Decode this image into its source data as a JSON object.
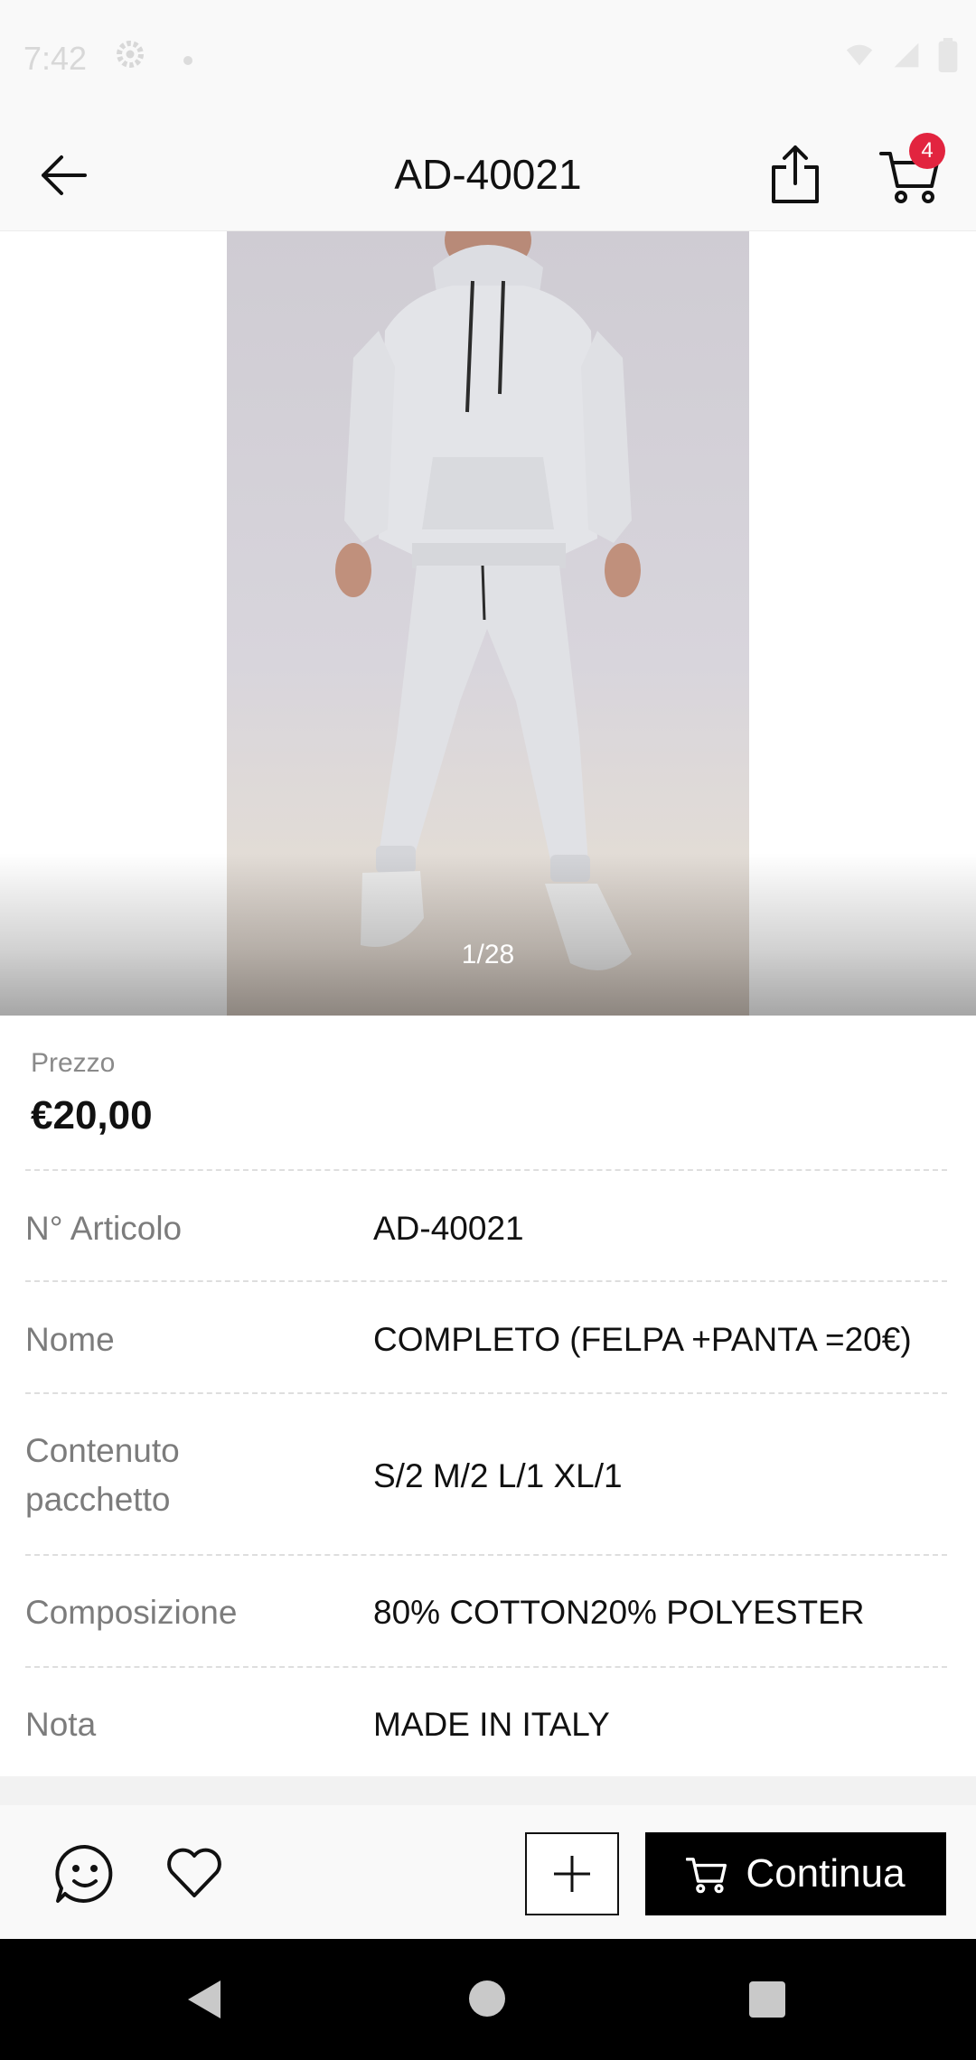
{
  "status_bar": {
    "time": "7:42"
  },
  "header": {
    "title": "AD-40021",
    "cart_count": "4"
  },
  "gallery": {
    "pager": "1/28"
  },
  "product": {
    "price_label": "Prezzo",
    "price": "€20,00",
    "details": [
      {
        "label": "N° Articolo",
        "value": "AD-40021"
      },
      {
        "label": "Nome",
        "value": "COMPLETO (FELPA +PANTA =20€)"
      },
      {
        "label": "Contenuto pacchetto",
        "value": "S/2 M/2 L/1 XL/1"
      },
      {
        "label": "Composizione",
        "value": "80% COTTON20% POLYESTER"
      },
      {
        "label": "Nota",
        "value": "MADE IN ITALY"
      }
    ]
  },
  "bottom_bar": {
    "continue_label": "Continua"
  },
  "colors": {
    "accent_badge": "#e2243f",
    "primary_button": "#000000"
  }
}
